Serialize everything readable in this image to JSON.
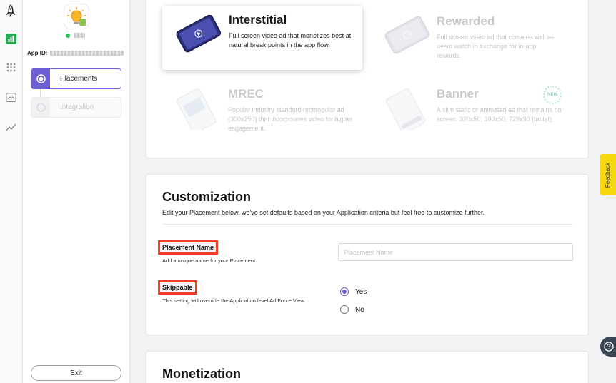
{
  "sidebar": {
    "app_id_label": "App ID:",
    "steps": [
      {
        "label": "Placements",
        "state": "active"
      },
      {
        "label": "Integration",
        "state": "inactive"
      }
    ],
    "exit_label": "Exit"
  },
  "ad_types": [
    {
      "title": "Interstitial",
      "description": "Full screen video ad that monetizes best at natural break points in the app flow.",
      "selected": true
    },
    {
      "title": "Rewarded",
      "description": "Full screen video ad that converts well as users watch in exchange for in-app rewards.",
      "selected": false
    },
    {
      "title": "MREC",
      "description": "Popular industry standard rectangular ad (300x250) that incorporates video for higher engagement.",
      "selected": false
    },
    {
      "title": "Banner",
      "description": "A slim static or animated ad that remains on screen. 320x50, 300x50, 728x90 (tablet).",
      "selected": false,
      "badge": "NEW"
    }
  ],
  "customization": {
    "title": "Customization",
    "subtitle": "Edit your Placement below, we've set defaults based on your Application criteria but feel free to customize further.",
    "placement_name": {
      "label": "Placement Name",
      "help": "Add a unique name for your Placement.",
      "placeholder": "Placement Name",
      "value": ""
    },
    "skippable": {
      "label": "Skippable",
      "help": "This setting will override the Application level Ad Force View.",
      "options": [
        {
          "label": "Yes",
          "selected": true
        },
        {
          "label": "No",
          "selected": false
        }
      ]
    }
  },
  "monetization": {
    "title": "Monetization"
  },
  "feedback_label": "Feedback",
  "colors": {
    "accent": "#6c5fd6",
    "highlight": "#f03e1e",
    "feedback": "#f6d90f",
    "status": "#25c25a"
  }
}
